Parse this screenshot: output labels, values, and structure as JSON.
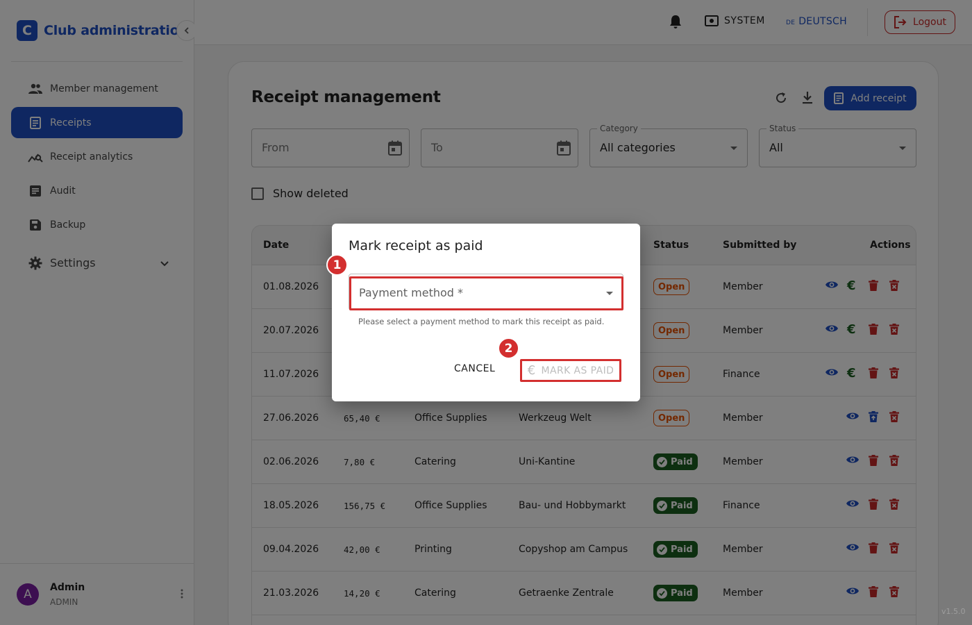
{
  "brand": {
    "logo_letter": "C",
    "title": "Club administration"
  },
  "sidebar": {
    "items": [
      {
        "label": "Member management",
        "icon": "people-icon"
      },
      {
        "label": "Receipts",
        "icon": "receipt-icon",
        "active": true
      },
      {
        "label": "Receipt analytics",
        "icon": "analytics-icon"
      },
      {
        "label": "Audit",
        "icon": "audit-icon"
      },
      {
        "label": "Backup",
        "icon": "save-icon"
      }
    ],
    "settings_label": "Settings"
  },
  "user": {
    "initial": "A",
    "name": "Admin",
    "role": "ADMIN"
  },
  "header": {
    "system_label": "SYSTEM",
    "lang_code": "DE",
    "lang_label": "DEUTSCH",
    "logout_label": "Logout"
  },
  "page": {
    "title": "Receipt management",
    "add_label": "Add receipt",
    "filters": {
      "from_placeholder": "From",
      "to_placeholder": "To",
      "category_label": "Category",
      "category_value": "All categories",
      "status_label": "Status",
      "status_value": "All"
    },
    "show_deleted_label": "Show deleted"
  },
  "table": {
    "headers": {
      "date": "Date",
      "status": "Status",
      "submitted_by": "Submitted by",
      "actions": "Actions"
    },
    "rows": [
      {
        "date": "01.08.2026",
        "amount": "",
        "category": "",
        "vendor": "",
        "status": "Open",
        "submitted_by": "Member"
      },
      {
        "date": "20.07.2026",
        "amount": "",
        "category": "",
        "vendor": "",
        "status": "Open",
        "submitted_by": "Member"
      },
      {
        "date": "11.07.2026",
        "amount": "",
        "category": "",
        "vendor": "",
        "status": "Open",
        "submitted_by": "Finance"
      },
      {
        "date": "27.06.2026",
        "amount": "65,40 €",
        "category": "Office Supplies",
        "vendor": "Werkzeug Welt",
        "status": "Open",
        "submitted_by": "Member"
      },
      {
        "date": "02.06.2026",
        "amount": "7,80 €",
        "category": "Catering",
        "vendor": "Uni-Kantine",
        "status": "Paid",
        "submitted_by": "Member"
      },
      {
        "date": "18.05.2026",
        "amount": "156,75 €",
        "category": "Office Supplies",
        "vendor": "Bau- und Hobbymarkt",
        "status": "Paid",
        "submitted_by": "Finance"
      },
      {
        "date": "09.04.2026",
        "amount": "42,00 €",
        "category": "Printing",
        "vendor": "Copyshop am Campus",
        "status": "Paid",
        "submitted_by": "Member"
      },
      {
        "date": "21.03.2026",
        "amount": "14,20 €",
        "category": "Catering",
        "vendor": "Getraenke Zentrale",
        "status": "Paid",
        "submitted_by": "Member"
      }
    ]
  },
  "dialog": {
    "title": "Mark receipt as paid",
    "field_placeholder": "Payment method *",
    "helper_text": "Please select a payment method to mark this receipt as paid.",
    "cancel_label": "CANCEL",
    "confirm_label": "MARK AS PAID",
    "step_1": "1",
    "step_2": "2"
  },
  "version": "v1.5.0",
  "colors": {
    "primary": "#1e4fc2",
    "danger": "#c62828",
    "open": "#e65100",
    "paid": "#1b5e20",
    "highlight": "#d32f2f"
  }
}
